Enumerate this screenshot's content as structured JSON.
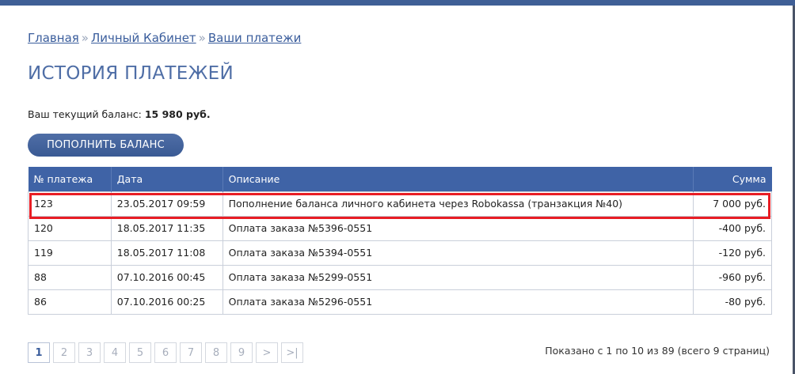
{
  "breadcrumb": {
    "items": [
      "Главная",
      "Личный Кабинет",
      "Ваши платежи"
    ],
    "separator": "»"
  },
  "page_title": "ИСТОРИЯ ПЛАТЕЖЕЙ",
  "balance": {
    "label": "Ваш текущий баланс:",
    "value": "15 980 руб."
  },
  "topup_button_label": "ПОПОЛНИТЬ БАЛАНС",
  "table": {
    "headers": [
      "№ платежа",
      "Дата",
      "Описание",
      "Сумма"
    ],
    "rows": [
      {
        "id": "123",
        "date": "23.05.2017 09:59",
        "description": "Пополнение баланса личного кабинета через Robokassa (транзакция №40)",
        "amount": "7 000 руб."
      },
      {
        "id": "120",
        "date": "18.05.2017 11:35",
        "description": "Оплата заказа №5396-0551",
        "amount": "-400 руб."
      },
      {
        "id": "119",
        "date": "18.05.2017 11:08",
        "description": "Оплата заказа №5394-0551",
        "amount": "-120 руб."
      },
      {
        "id": "88",
        "date": "07.10.2016 00:45",
        "description": "Оплата заказа №5299-0551",
        "amount": "-960 руб."
      },
      {
        "id": "86",
        "date": "07.10.2016 00:25",
        "description": "Оплата заказа №5296-0551",
        "amount": "-80 руб."
      }
    ],
    "highlighted_row": 0
  },
  "pagination": {
    "pages": [
      "1",
      "2",
      "3",
      "4",
      "5",
      "6",
      "7",
      "8",
      "9"
    ],
    "current": "1",
    "next_label": ">",
    "last_label": ">|"
  },
  "summary": "Показано с 1 по 10 из 89 (всего 9 страниц)",
  "colors": {
    "accent": "#3f63a6",
    "highlight": "#e81d24",
    "link": "#3a5d9c"
  }
}
